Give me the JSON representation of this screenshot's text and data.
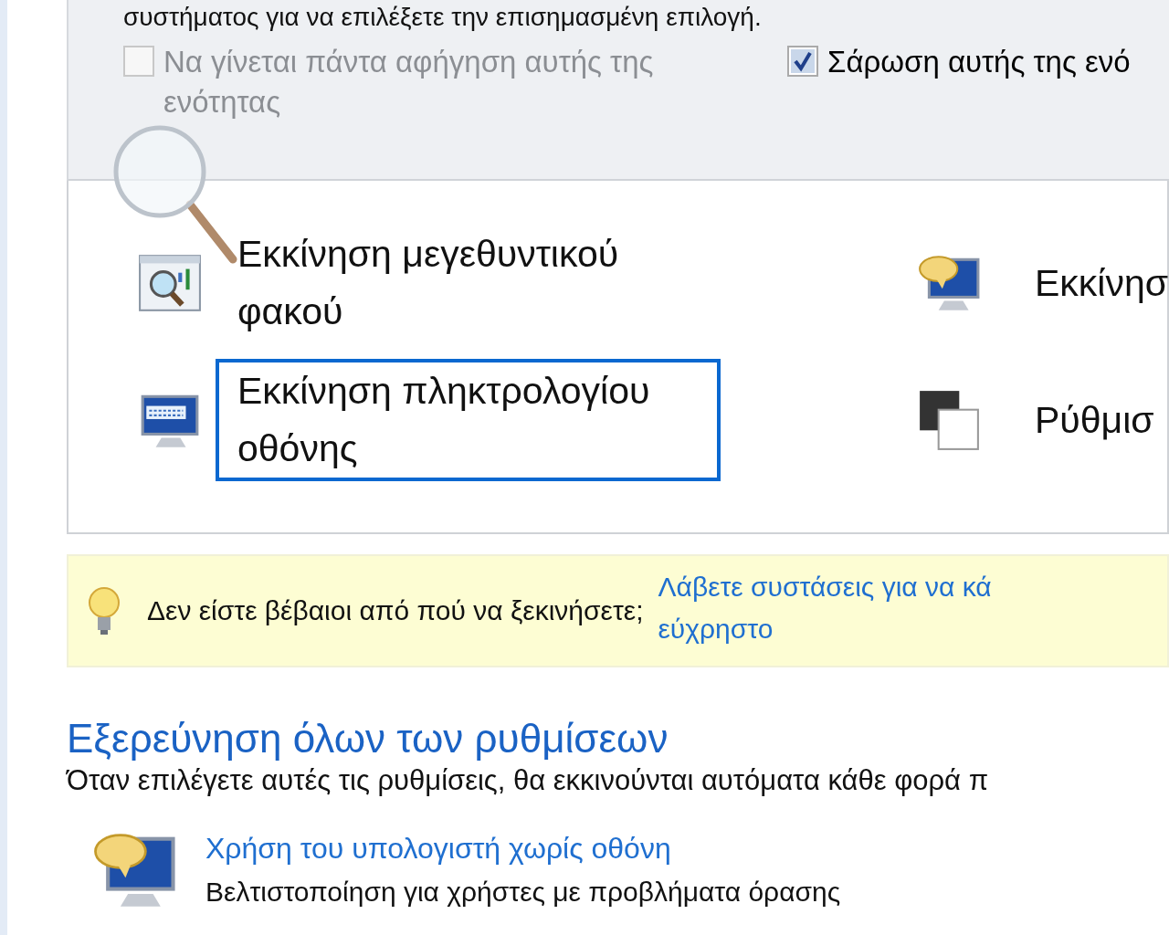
{
  "intro_text": "συστήματος για να επιλέξετε την επισημασμένη επιλογή.",
  "options": [
    {
      "label": "Να γίνεται πάντα αφήγηση αυτής της ενότητας",
      "checked": false,
      "disabled": true
    },
    {
      "label": "Σάρωση αυτής της ενό",
      "checked": true,
      "disabled": false
    }
  ],
  "quick_access": [
    {
      "kind": "magnifier",
      "label": "Εκκίνηση μεγεθυντικού φακού",
      "focused": false
    },
    {
      "kind": "narrator",
      "label": "Εκκίνησ",
      "focused": false
    },
    {
      "kind": "keyboard",
      "label": "Εκκίνηση πληκτρολογίου οθόνης",
      "focused": true
    },
    {
      "kind": "contrast",
      "label": "Ρύθμισ",
      "focused": false
    }
  ],
  "tip": {
    "text": "Δεν είστε βέβαιοι από πού να ξεκινήσετε;",
    "link_lines": [
      "Λάβετε συστάσεις για να κά",
      "εύχρηστο"
    ]
  },
  "explore": {
    "title": "Εξερεύνηση όλων των ρυθμίσεων",
    "description": "Όταν επιλέγετε αυτές τις ρυθμίσεις, θα εκκινούνται αυτόματα κάθε φορά π",
    "items": [
      {
        "kind": "narrator",
        "title": "Χρήση του υπολογιστή χωρίς οθόνη",
        "description": "Βελτιστοποίηση για χρήστες με προβλήματα όρασης"
      }
    ]
  }
}
